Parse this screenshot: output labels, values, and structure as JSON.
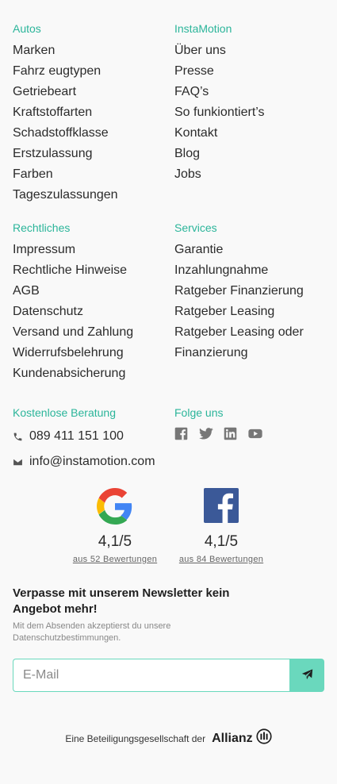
{
  "autos": {
    "title": "Autos",
    "items": [
      "Marken",
      "Fahrz eugtypen",
      "Getriebeart",
      "Kraftstoffarten",
      "Schadstoffklasse",
      "Erstzulassung",
      "Farben",
      "Tageszulassungen"
    ]
  },
  "instamotion": {
    "title": "InstaMotion",
    "items": [
      "Über uns",
      "Presse",
      "FAQ’s",
      "So funkiontiert’s",
      "Kontakt",
      "Blog",
      "Jobs"
    ]
  },
  "rechtliches": {
    "title": "Rechtliches",
    "items": [
      "Impressum",
      "Rechtliche Hinweise",
      "AGB",
      "Datenschutz",
      "Versand und Zahlung",
      "Widerrufsbelehrung",
      "Kundenabsicherung"
    ]
  },
  "services": {
    "title": "Services",
    "items": [
      "Garantie",
      "Inzahlungnahme",
      "Ratgeber Finanzierung",
      "Ratgeber Leasing",
      "Ratgeber Leasing oder",
      "Finanzierung"
    ]
  },
  "beratung": {
    "title": "Kostenlose Beratung",
    "phone": "089 411 151 100",
    "email": "info@instamotion.com"
  },
  "social": {
    "title": "Folge uns",
    "icons": [
      "facebook-icon",
      "twitter-icon",
      "linkedin-icon",
      "youtube-icon"
    ]
  },
  "ratings": {
    "google": {
      "score": "4,1/5",
      "count": "aus 52 Bewertungen"
    },
    "facebook": {
      "score": "4,1/5",
      "count": "aus 84 Bewertungen"
    }
  },
  "newsletter": {
    "title": "Verpasse mit unserem Newsletter kein Angebot mehr!",
    "subtitle": "Mit dem Absenden akzeptierst du unsere Datenschutzbestimmungen.",
    "placeholder": "E-Mail"
  },
  "footer": {
    "text": "Eine Beteiligungsgesellschaft der",
    "brand": "Allianz"
  },
  "colors": {
    "accent": "#2bb59a",
    "button": "#6ad8bd",
    "facebook": "#3b5998"
  }
}
